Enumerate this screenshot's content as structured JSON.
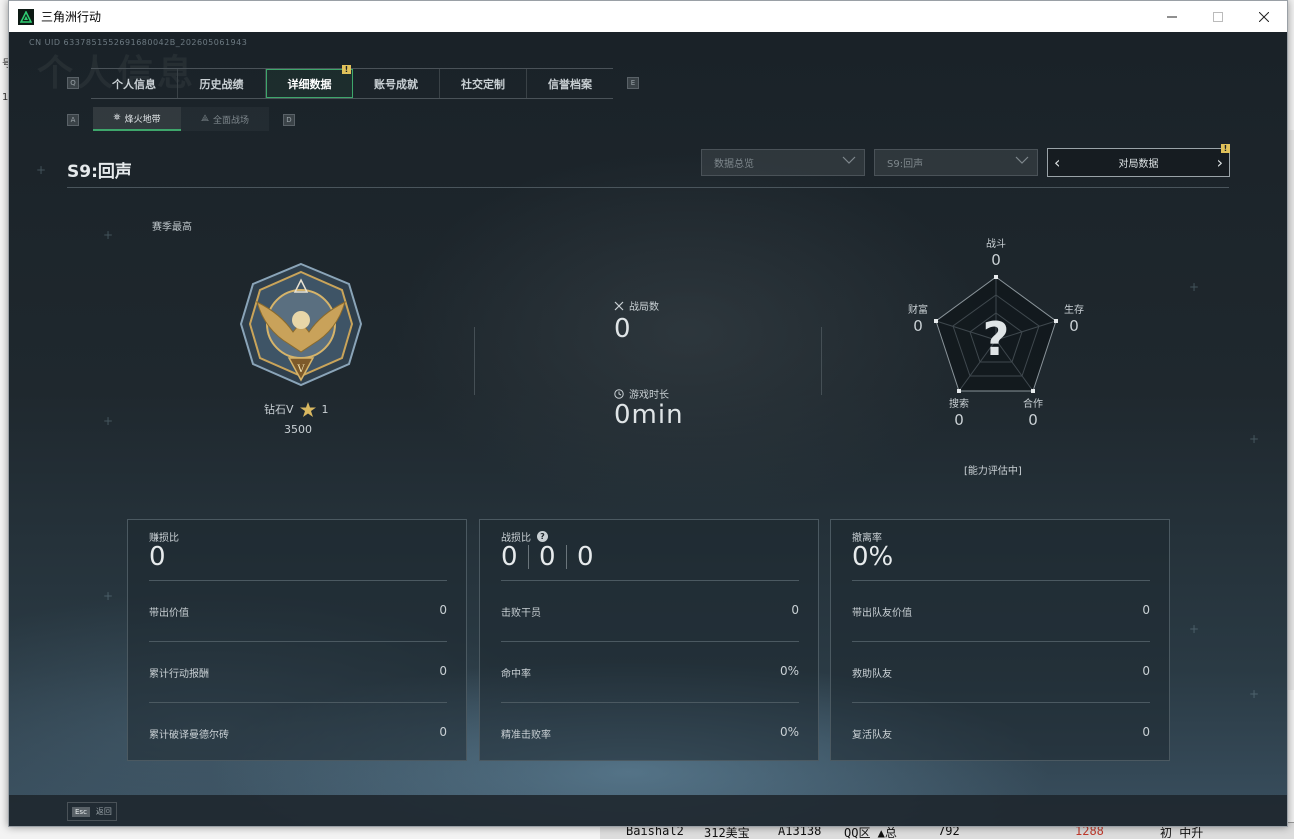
{
  "window": {
    "title": "三角洲行动"
  },
  "uid": "CN UID 6337851552691680042B_202605061943",
  "watermark": "个人信息",
  "tabs": {
    "left_key": "Q",
    "right_key": "E",
    "items": [
      "个人信息",
      "历史战绩",
      "详细数据",
      "账号成就",
      "社交定制",
      "信誉档案"
    ],
    "active_index": 2,
    "badge": "!"
  },
  "subtabs": {
    "left_key": "A",
    "right_key": "D",
    "items": [
      "烽火地带",
      "全面战场"
    ],
    "active_index": 0
  },
  "header": {
    "season": "S9:回声",
    "dropdown_1": "数据总览",
    "dropdown_2": "S9:回声",
    "match_selector": "对局数据",
    "badge": "!"
  },
  "rank": {
    "season_best_label": "赛季最高",
    "name": "钻石V",
    "stars": "1",
    "score": "3500"
  },
  "stats": {
    "matches_label": "战局数",
    "matches_value": "0",
    "playtime_label": "游戏时长",
    "playtime_value": "0min"
  },
  "radar": {
    "combat_label": "战斗",
    "combat_value": "0",
    "survival_label": "生存",
    "survival_value": "0",
    "coop_label": "合作",
    "coop_value": "0",
    "search_label": "搜索",
    "search_value": "0",
    "wealth_label": "财富",
    "wealth_value": "0",
    "question": "?",
    "status": "[能力评估中]"
  },
  "panel_profit": {
    "title": "赚损比",
    "value": "0",
    "rows": [
      {
        "label": "带出价值",
        "value": "0"
      },
      {
        "label": "累计行动报酬",
        "value": "0"
      },
      {
        "label": "累计破译曼德尔砖",
        "value": "0"
      }
    ]
  },
  "panel_kd": {
    "title": "战损比",
    "help": "?",
    "values": [
      "0",
      "0",
      "0"
    ],
    "rows": [
      {
        "label": "击败干员",
        "value": "0"
      },
      {
        "label": "命中率",
        "value": "0%"
      },
      {
        "label": "精准击败率",
        "value": "0%"
      }
    ]
  },
  "panel_extract": {
    "title": "撤离率",
    "value": "0%",
    "rows": [
      {
        "label": "带出队友价值",
        "value": "0"
      },
      {
        "label": "救助队友",
        "value": "0"
      },
      {
        "label": "复活队友",
        "value": "0"
      }
    ]
  },
  "bottom": {
    "esc_key": "Esc",
    "back_label": "返回"
  },
  "background_app": {
    "bottom_row": [
      "Baishal2",
      "312美宝",
      "A13138",
      "QQ区 ▲总",
      "792",
      "1288",
      "初 中升"
    ]
  },
  "colors": {
    "accent": "#3ea66b",
    "badge": "#e0c15a"
  }
}
